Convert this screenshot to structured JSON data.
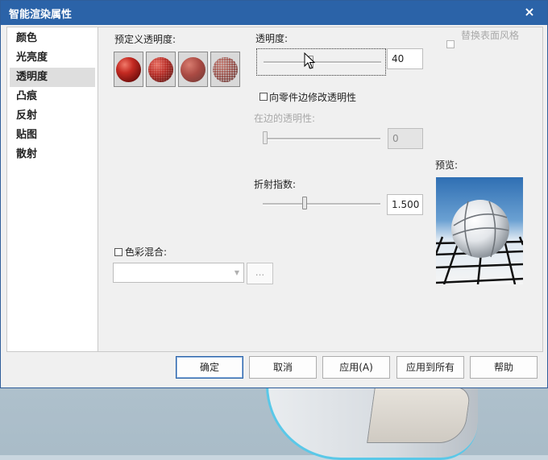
{
  "dialog": {
    "title": "智能渲染属性",
    "close_glyph": "×"
  },
  "nav": {
    "items": [
      {
        "label": "颜色",
        "active": false
      },
      {
        "label": "光亮度",
        "active": false
      },
      {
        "label": "透明度",
        "active": true
      },
      {
        "label": "凸痕",
        "active": false
      },
      {
        "label": "反射",
        "active": false
      },
      {
        "label": "贴图",
        "active": false
      },
      {
        "label": "散射",
        "active": false
      }
    ]
  },
  "presets": {
    "label": "预定义透明度:",
    "items": [
      {
        "icon": "opaque-sphere-icon"
      },
      {
        "icon": "dotted-sphere-icon"
      },
      {
        "icon": "semi-transparent-sphere-icon"
      },
      {
        "icon": "mesh-sphere-icon"
      }
    ]
  },
  "transparency": {
    "label": "透明度:",
    "value": "40",
    "fraction": 0.4
  },
  "replace_surface_style": {
    "label": "替换表面风格",
    "checked": false,
    "disabled": true
  },
  "edge_modify": {
    "label": "向零件边修改透明性",
    "checked": false
  },
  "edge_transparency": {
    "label": "在边的透明性:",
    "value": "0",
    "fraction": 0.0,
    "disabled": true
  },
  "refraction": {
    "label": "折射指数:",
    "value": "1.500",
    "fraction": 0.35
  },
  "preview": {
    "label": "预览:"
  },
  "color_blend": {
    "label": "色彩混合:",
    "checked": false,
    "selected": "",
    "dots_label": "..."
  },
  "buttons": {
    "ok": "确定",
    "cancel": "取消",
    "apply": "应用(A)",
    "apply_all": "应用到所有",
    "help": "帮助"
  },
  "colors": {
    "titlebar": "#2b63a8",
    "sphere_red": "#b3231f"
  }
}
